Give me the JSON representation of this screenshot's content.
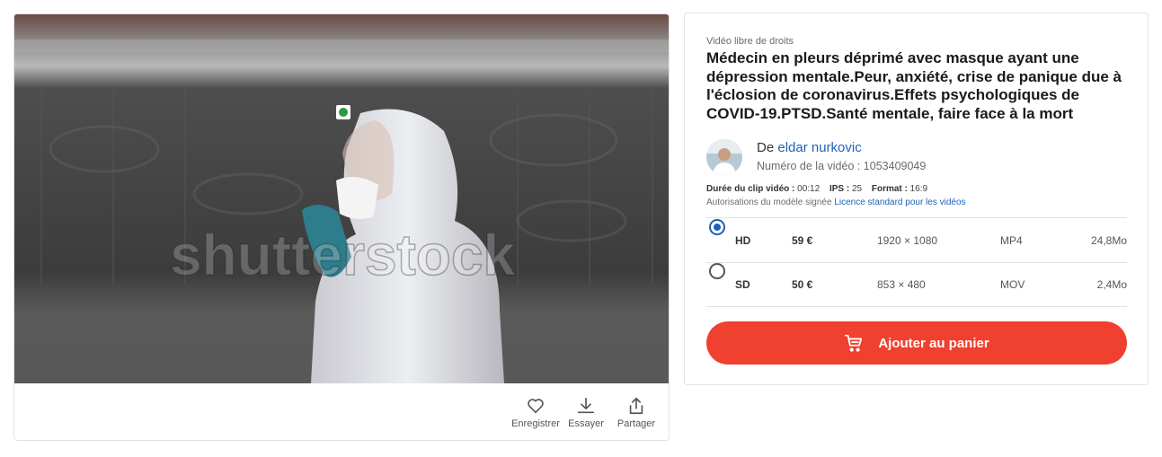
{
  "media": {
    "watermark": "shutterstock",
    "actions": [
      {
        "icon": "heart-icon",
        "label": "Enregistrer"
      },
      {
        "icon": "download-icon",
        "label": "Essayer"
      },
      {
        "icon": "share-icon",
        "label": "Partager"
      }
    ]
  },
  "info": {
    "eyebrow": "Vidéo libre de droits",
    "title": "Médecin en pleurs déprimé avec masque ayant une dépression mentale.Peur, anxiété, crise de panique due à l'éclosion de coronavirus.Effets psychologiques de COVID-19.PTSD.Santé mentale, faire face à la mort",
    "author_prefix": "De",
    "author_name": "eldar nurkovic",
    "video_id": "Numéro de la vidéo : 1053409049",
    "meta": {
      "duration_label": "Durée du clip vidéo :",
      "duration_value": "00:12",
      "fps_label": "IPS :",
      "fps_value": "25",
      "format_label": "Format :",
      "format_value": "16:9"
    },
    "license": {
      "prefix": "Autorisations du modèle signée",
      "link": "Licence standard pour les vidéos"
    },
    "options": [
      {
        "quality": "HD",
        "price": "59 €",
        "resolution": "1920 × 1080",
        "format": "MP4",
        "size": "24,8Mo",
        "selected": true
      },
      {
        "quality": "SD",
        "price": "50 €",
        "resolution": "853 × 480",
        "format": "MOV",
        "size": "2,4Mo",
        "selected": false
      }
    ],
    "cart_label": "Ajouter au panier"
  },
  "colors": {
    "accent": "#f0402f",
    "link": "#1e62b8",
    "radio_selected": "#1e62b8",
    "border": "#e2e2e2"
  }
}
